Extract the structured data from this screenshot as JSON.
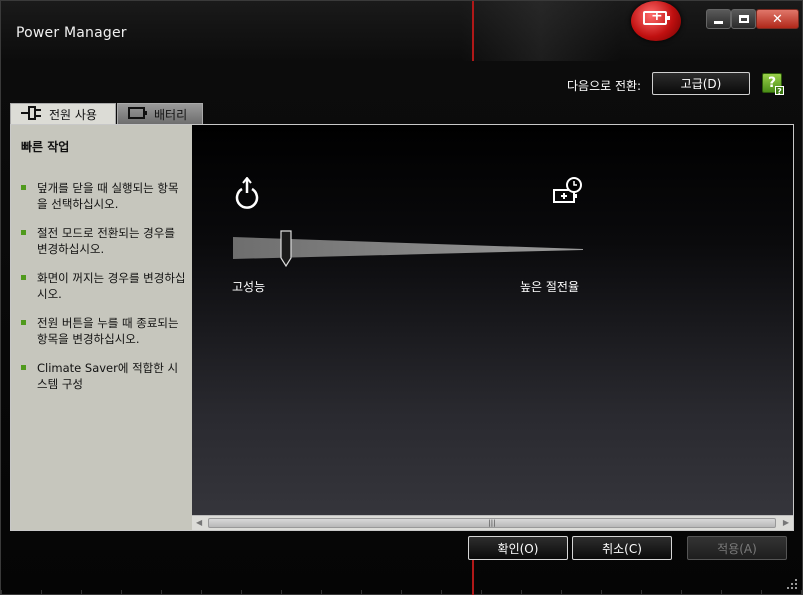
{
  "window": {
    "title": "Power Manager",
    "controls": {
      "minimize": "minimize-icon",
      "maximize": "maximize-icon",
      "close": "close-icon"
    }
  },
  "header": {
    "switch_label": "다음으로 전환:",
    "switch_button": "고급(D)",
    "help_icon": "help-icon"
  },
  "tabs": [
    {
      "label": "전원 사용",
      "icon": "plug-icon",
      "active": true
    },
    {
      "label": "배터리",
      "icon": "battery-icon",
      "active": false
    }
  ],
  "sidebar": {
    "title": "빠른 작업",
    "items": [
      {
        "label": "덮개를 닫을 때 실행되는 항목을 선택하십시오."
      },
      {
        "label": "절전 모드로 전환되는 경우를 변경하십시오."
      },
      {
        "label": "화면이 꺼지는 경우를 변경하십시오."
      },
      {
        "label": "전원 버튼을 누를 때 종료되는 항목을 변경하십시오."
      },
      {
        "label": "Climate Saver에 적합한 시스템 구성"
      }
    ]
  },
  "slider": {
    "left_label": "고성능",
    "right_label": "높은 절전율",
    "level": 0.15,
    "left_icon": "power-icon",
    "right_icon": "battery-timer-icon"
  },
  "footer": {
    "ok": "확인(O)",
    "cancel": "취소(C)",
    "apply": "적용(A)"
  },
  "colors": {
    "accent_green": "#4f9a1c",
    "sidebar_bg": "#c6c6bd",
    "badge_red": "#c01010"
  }
}
